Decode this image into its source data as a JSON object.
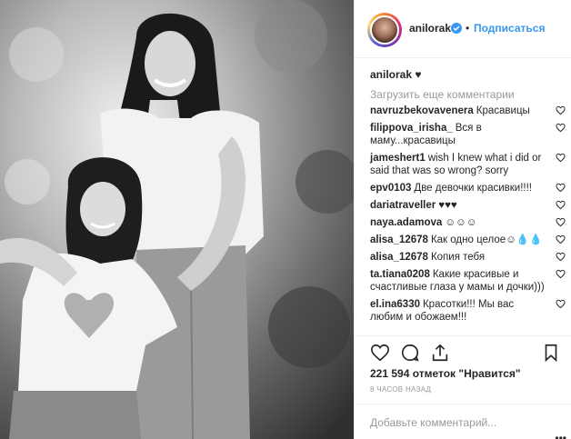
{
  "header": {
    "username": "anilorak",
    "separator": "•",
    "follow_label": "Подписаться"
  },
  "caption": {
    "username": "anilorak",
    "text": "♥"
  },
  "load_more": "Загрузить еще комментарии",
  "comments": [
    {
      "user": "navruzbekovavenera",
      "text": "Красавицы"
    },
    {
      "user": "filippova_irisha_",
      "text": "Вся в маму...красавицы"
    },
    {
      "user": "jameshert1",
      "text": "wish I knew what i did or said that was so wrong? sorry"
    },
    {
      "user": "epv0103",
      "text": "Две девочки красивки!!!!"
    },
    {
      "user": "dariatraveller",
      "text": "♥♥♥"
    },
    {
      "user": "naya.adamova",
      "text": "☺☺☺"
    },
    {
      "user": "alisa_12678",
      "text": "Как одно целое☺💧💧"
    },
    {
      "user": "alisa_12678",
      "text": "Копия тебя"
    },
    {
      "user": "ta.tiana0208",
      "text": "Какие красивые и счастливые глаза у мамы и дочки)))"
    },
    {
      "user": "el.ina6330",
      "text": "Красотки!!! Мы вас любим и обожаем!!!"
    }
  ],
  "likes": "221 594 отметок \"Нравится\"",
  "time": "8 ЧАСОВ НАЗАД",
  "add_comment_placeholder": "Добавьте комментарий...",
  "more_dots": "•••",
  "icons": {
    "like": "heart-outline-icon",
    "comment": "speech-bubble-icon",
    "share": "share-arrow-icon",
    "save": "bookmark-icon",
    "verified": "verified-badge-icon"
  },
  "colors": {
    "link_blue": "#3897f0",
    "muted": "#999999",
    "text": "#262626",
    "border": "#efefef"
  }
}
